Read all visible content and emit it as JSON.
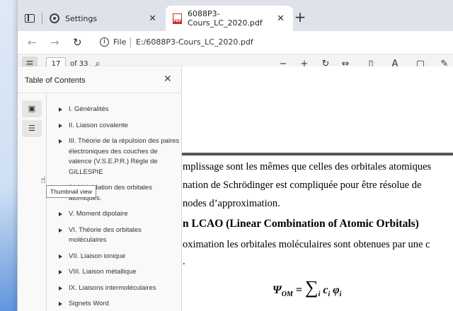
{
  "browser": {
    "tabs": [
      {
        "label": "Settings",
        "active": false
      },
      {
        "label": "6088P3-Cours_LC_2020.pdf",
        "active": true
      }
    ],
    "pdf_icon_text": "PDF",
    "address": {
      "scheme_label": "File",
      "url": "E:/6088P3-Cours_LC_2020.pdf"
    }
  },
  "pdf_toolbar": {
    "current_page": "17",
    "page_count_label": "of 33"
  },
  "toc": {
    "title": "Table of Contents",
    "tooltip": "Thumbnail view",
    "items": [
      "I. Généralités",
      "II. Liaison covalente",
      "III. Théorie de la répulsion des paires électroniques des couches de valence (V.S.E.P.R.) Règle de GILLESPIE",
      "IV. Hybridation des orbitales atomiques.",
      "V. Moment dipolaire",
      "VI. Théorie des orbitales moléculaires",
      "VII. Liaison ionique",
      "VIII. Liaison métallique",
      "IX. Liaisons intermoléculaires",
      "Signets Word"
    ]
  },
  "document": {
    "lines": [
      "mplissage sont les mêmes que celles des orbitales atomiques",
      "nation de Schrödinger est compliquée pour être résolue de",
      "nodes d’approximation.",
      "n LCAO (Linear Combination of Atomic Orbitals)",
      "oximation les orbitales moléculaires sont obtenues par une c",
      "."
    ],
    "formula": {
      "lhs": "Ψ",
      "lhs_sub": "OM",
      "eq": " = ",
      "sum": "∑",
      "sum_sub": "i",
      "term": "c",
      "term_sub": "i",
      "term2": " φ",
      "term2_sub": "i"
    }
  }
}
